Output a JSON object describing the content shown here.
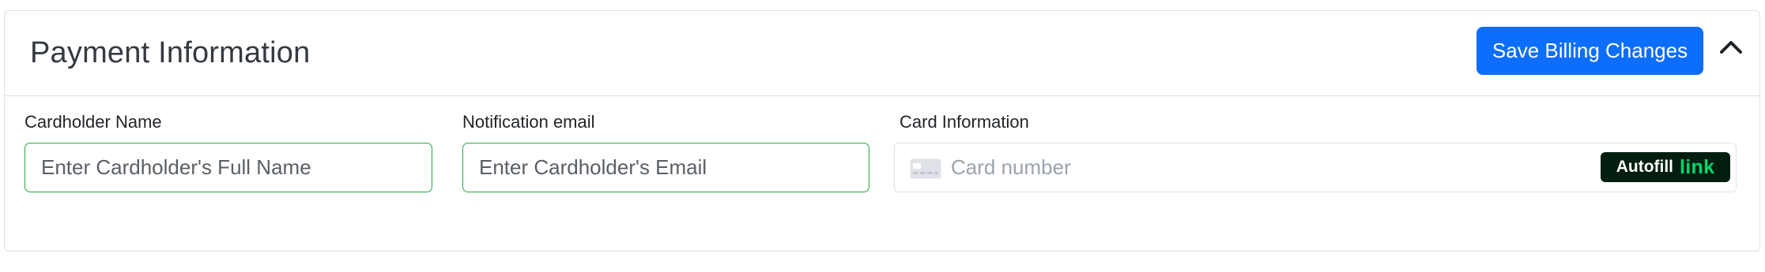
{
  "header": {
    "title": "Payment Information",
    "save_label": "Save Billing Changes",
    "collapse_icon": "chevron-up-icon"
  },
  "fields": {
    "cardholder_name": {
      "label": "Cardholder Name",
      "value": "",
      "placeholder": "Enter Cardholder's Full Name"
    },
    "notification_email": {
      "label": "Notification email",
      "value": "",
      "placeholder": "Enter Cardholder's Email"
    },
    "card_information": {
      "label": "Card Information",
      "card_icon": "credit-card-icon",
      "card_number_placeholder": "Card number",
      "autofill_label": "Autofill",
      "autofill_brand": "link"
    }
  },
  "colors": {
    "primary": "#0d6efd",
    "valid_border": "#28a745",
    "link_brand_green": "#00d66f",
    "link_brand_bg": "#011e0f"
  }
}
